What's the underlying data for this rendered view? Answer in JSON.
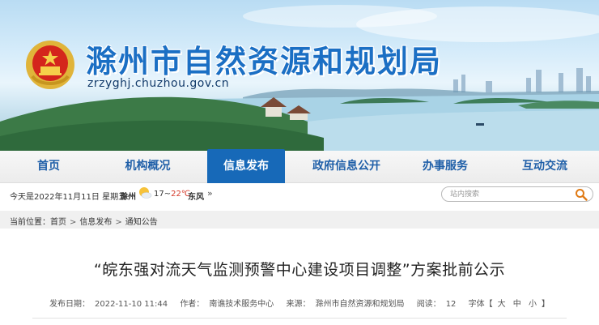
{
  "header": {
    "site_title": "滁州市自然资源和规划局",
    "site_url": "zrzyghj.chuzhou.gov.cn"
  },
  "nav": {
    "items": [
      {
        "label": "首页"
      },
      {
        "label": "机构概况"
      },
      {
        "label": "信息发布",
        "active": true
      },
      {
        "label": "政府信息公开"
      },
      {
        "label": "办事服务"
      },
      {
        "label": "互动交流"
      }
    ],
    "active_color": "#1769b8"
  },
  "infobar": {
    "date": "今天是2022年11月11日 星期五",
    "city": "滁州",
    "weather_icon": "sun-cloud-icon",
    "temp_low": "17",
    "temp_sep": "~",
    "temp_high": "22℃",
    "wind": "东风",
    "wind_suffix": "»"
  },
  "search": {
    "placeholder": "站内搜索",
    "icon": "search-icon"
  },
  "breadcrumb": {
    "prefix": "当前位置：",
    "items": [
      "首页",
      "信息发布",
      "通知公告"
    ],
    "separator": ">"
  },
  "article": {
    "title": "“皖东强对流天气监测预警中心建设项目调整”方案批前公示",
    "meta": {
      "published_label": "发布日期：",
      "published": "2022-11-10 11:44",
      "author_label": "作者：",
      "author": "南谯技术服务中心",
      "source_label": "来源：",
      "source": "滁州市自然资源和规划局",
      "views_label": "阅读：",
      "views": "12",
      "font_label": "字体【",
      "font_large": "大",
      "font_medium": "中",
      "font_small": "小",
      "font_close": "】"
    }
  }
}
